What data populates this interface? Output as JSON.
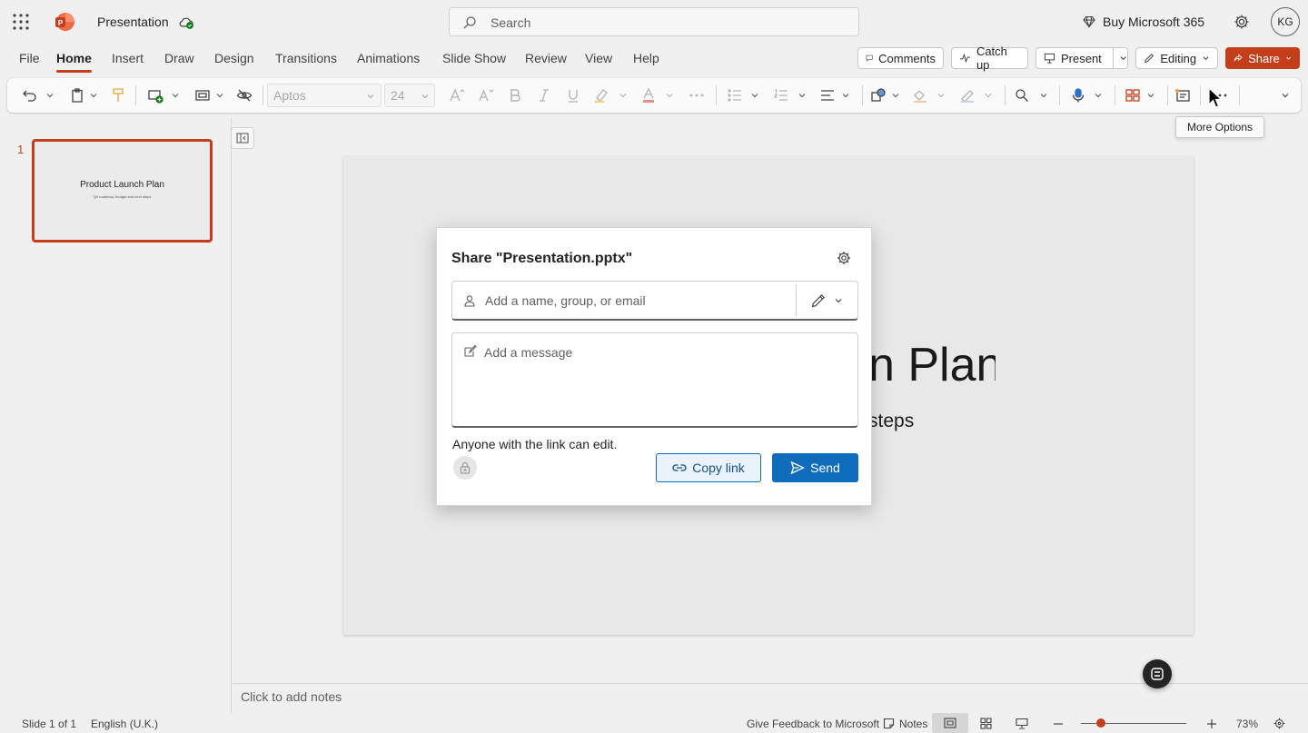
{
  "titlebar": {
    "doc_title": "Presentation",
    "search_placeholder": "Search",
    "buy_label": "Buy Microsoft 365",
    "avatar_initials": "KG"
  },
  "menu": {
    "tabs": [
      "File",
      "Home",
      "Insert",
      "Draw",
      "Design",
      "Transitions",
      "Animations",
      "Slide Show",
      "Review",
      "View",
      "Help"
    ],
    "active_tab": "Home",
    "comments_label": "Comments",
    "catchup_label": "Catch up",
    "present_label": "Present",
    "editing_label": "Editing",
    "share_label": "Share"
  },
  "ribbon": {
    "font_name": "Aptos",
    "font_size": "24",
    "tooltip": "More Options"
  },
  "thumbnail": {
    "number": "1",
    "title": "Product Launch Plan",
    "subtitle": "Q4 roadmap, budget and next steps"
  },
  "slide": {
    "title_visible": "n Plan",
    "subtitle_visible": "steps"
  },
  "share_dialog": {
    "title": "Share \"Presentation.pptx\"",
    "people_placeholder": "Add a name, group, or email",
    "message_placeholder": "Add a message",
    "link_note": "Anyone with the link can edit.",
    "copy_link_label": "Copy link",
    "send_label": "Send"
  },
  "notes": {
    "placeholder": "Click to add notes"
  },
  "status": {
    "slide_info": "Slide 1 of 1",
    "language": "English (U.K.)",
    "feedback": "Give Feedback to Microsoft",
    "notes_label": "Notes",
    "zoom": "73%"
  },
  "colors": {
    "accent": "#c43e1c",
    "primary_blue": "#0f6cbd"
  }
}
